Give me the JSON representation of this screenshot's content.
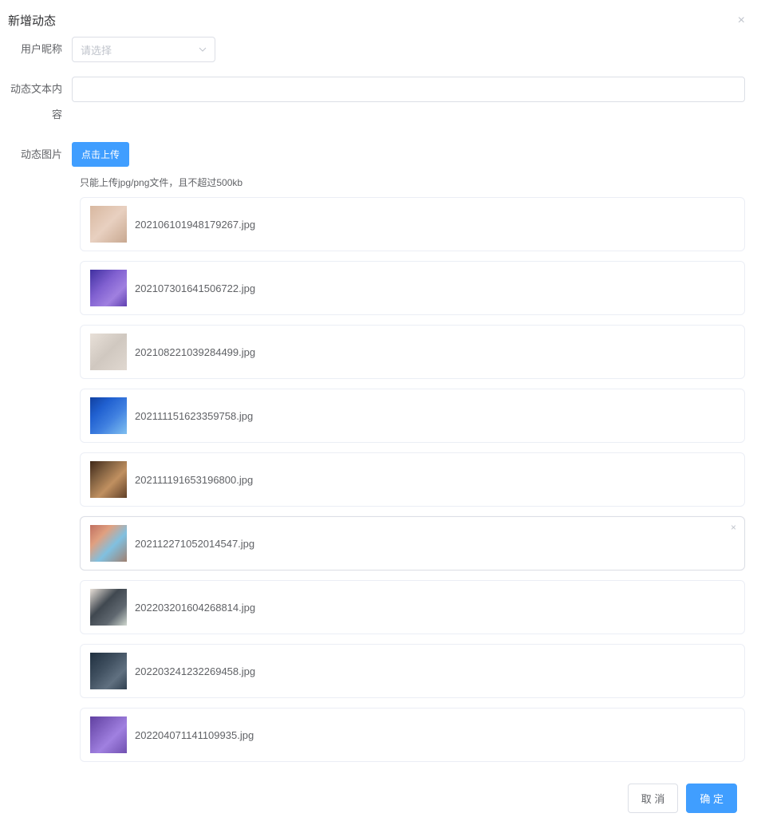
{
  "dialog": {
    "title": "新增动态",
    "close_icon": "×"
  },
  "form": {
    "user_label": "用户昵称",
    "user_placeholder": "请选择",
    "content_label": "动态文本内容",
    "content_value": "",
    "image_label": "动态图片",
    "upload_button": "点击上传",
    "upload_tip": "只能上传jpg/png文件，且不超过500kb"
  },
  "files": [
    {
      "name": "202106101948179267.jpg",
      "thumb_class": "th1",
      "hover": false
    },
    {
      "name": "202107301641506722.jpg",
      "thumb_class": "th2",
      "hover": false
    },
    {
      "name": "202108221039284499.jpg",
      "thumb_class": "th3",
      "hover": false
    },
    {
      "name": "202111151623359758.jpg",
      "thumb_class": "th4",
      "hover": false
    },
    {
      "name": "202111191653196800.jpg",
      "thumb_class": "th5",
      "hover": false
    },
    {
      "name": "202112271052014547.jpg",
      "thumb_class": "th6",
      "hover": true
    },
    {
      "name": "202203201604268814.jpg",
      "thumb_class": "th7",
      "hover": false
    },
    {
      "name": "202203241232269458.jpg",
      "thumb_class": "th8",
      "hover": false
    },
    {
      "name": "202204071141109935.jpg",
      "thumb_class": "th9",
      "hover": false
    }
  ],
  "footer": {
    "cancel": "取 消",
    "confirm": "确 定"
  }
}
